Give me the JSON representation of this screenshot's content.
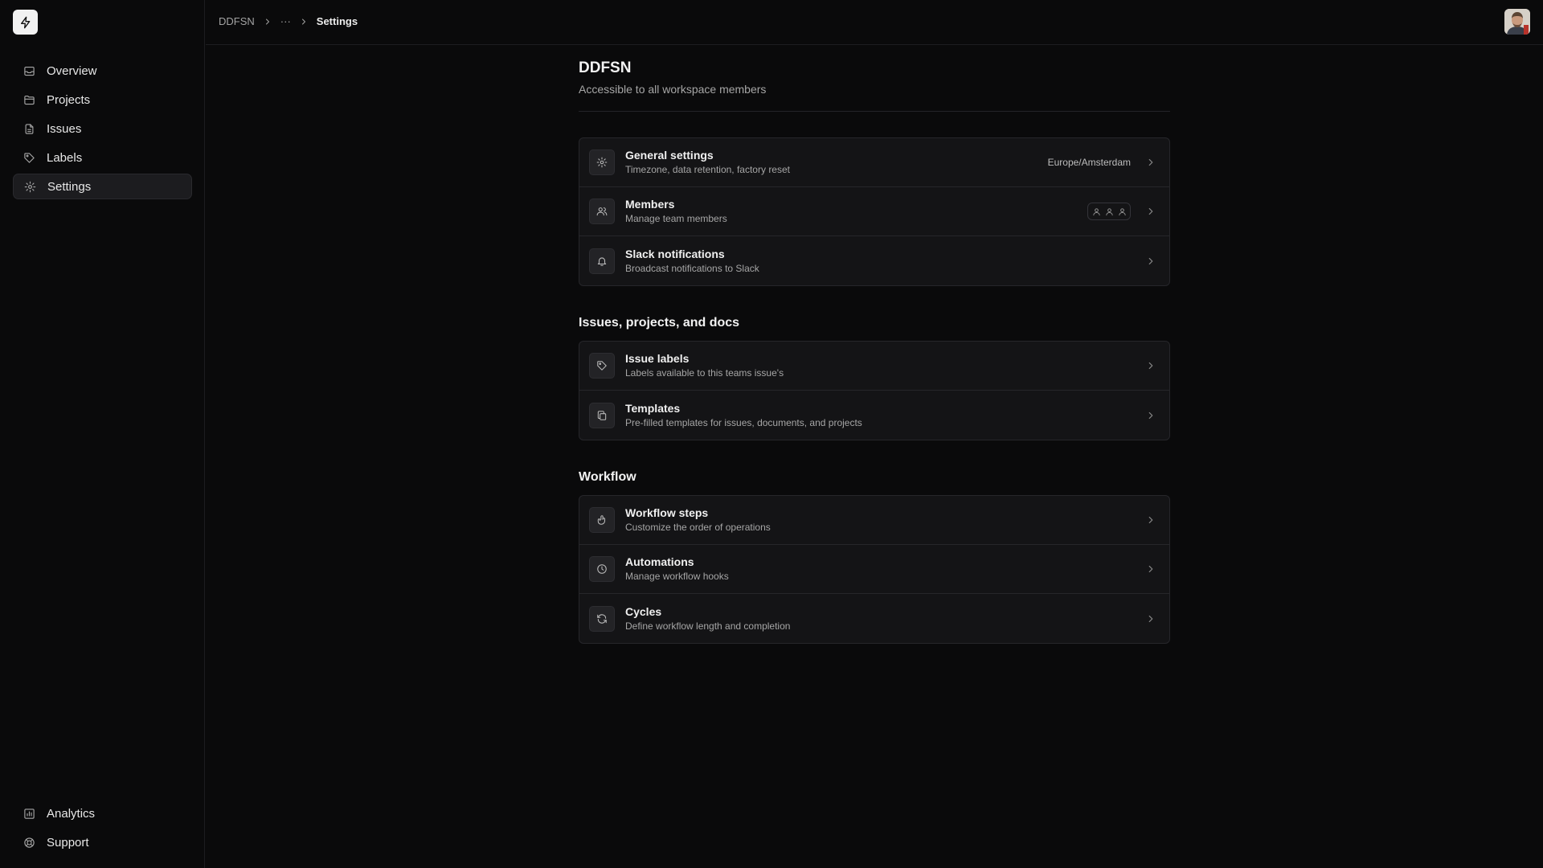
{
  "sidebar": {
    "items": [
      {
        "label": "Overview",
        "icon": "inbox-icon"
      },
      {
        "label": "Projects",
        "icon": "folder-icon"
      },
      {
        "label": "Issues",
        "icon": "file-icon"
      },
      {
        "label": "Labels",
        "icon": "tag-icon"
      },
      {
        "label": "Settings",
        "icon": "gear-icon",
        "active": true
      }
    ],
    "bottom_items": [
      {
        "label": "Analytics",
        "icon": "chart-icon"
      },
      {
        "label": "Support",
        "icon": "lifebuoy-icon"
      }
    ]
  },
  "breadcrumb": {
    "root": "DDFSN",
    "ellipsis": "···",
    "current": "Settings"
  },
  "header": {
    "title": "DDFSN",
    "subtitle": "Accessible to all workspace members"
  },
  "general": {
    "rows": [
      {
        "title": "General settings",
        "desc": "Timezone, data retention, factory reset",
        "meta": "Europe/Amsterdam",
        "icon": "gear-icon"
      },
      {
        "title": "Members",
        "desc": "Manage team members",
        "icon": "users-icon"
      },
      {
        "title": "Slack notifications",
        "desc": "Broadcast notifications to Slack",
        "icon": "bell-icon"
      }
    ]
  },
  "issues_section": {
    "title": "Issues, projects, and docs",
    "rows": [
      {
        "title": "Issue labels",
        "desc": "Labels available to this teams issue's",
        "icon": "tag-icon"
      },
      {
        "title": "Templates",
        "desc": "Pre-filled templates for issues, documents, and projects",
        "icon": "copy-icon"
      }
    ]
  },
  "workflow_section": {
    "title": "Workflow",
    "rows": [
      {
        "title": "Workflow steps",
        "desc": "Customize the order of operations",
        "icon": "hand-pointer-icon"
      },
      {
        "title": "Automations",
        "desc": "Manage workflow hooks",
        "icon": "clock-icon"
      },
      {
        "title": "Cycles",
        "desc": "Define workflow length and completion",
        "icon": "refresh-icon"
      }
    ]
  },
  "colors": {
    "background": "#0a0a0b",
    "card": "#141416",
    "border": "#26262a",
    "text": "#ededed",
    "muted": "#a6a6a6"
  }
}
